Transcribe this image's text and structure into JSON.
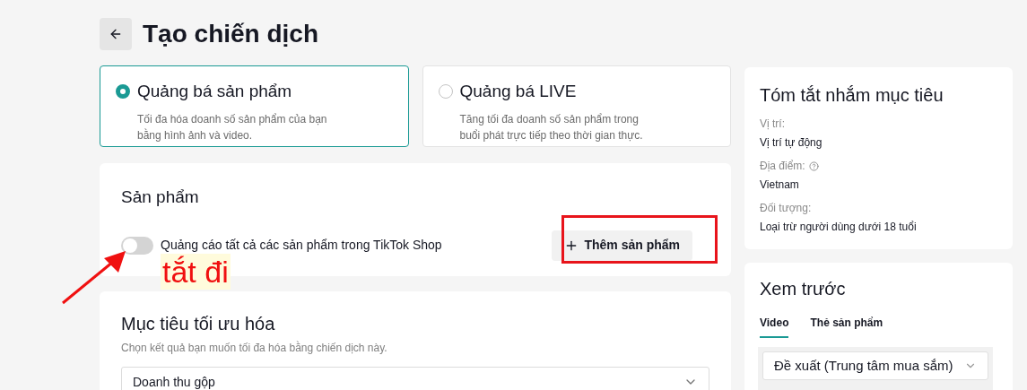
{
  "header": {
    "title": "Tạo chiến dịch"
  },
  "promo_options": [
    {
      "title": "Quảng bá sản phẩm",
      "description": "Tối đa hóa doanh số sản phẩm của bạn\nbằng hình ảnh và video.",
      "selected": true
    },
    {
      "title": "Quảng bá LIVE",
      "description": "Tăng tối đa doanh số sản phẩm trong\nbuổi phát trực tiếp theo thời gian thực.",
      "selected": false
    }
  ],
  "products": {
    "title": "Sản phẩm",
    "toggle": {
      "label": "Quảng cáo tất cả các sản phẩm trong TikTok Shop",
      "on": false
    },
    "add_button": "Thêm sản phẩm"
  },
  "annotation": {
    "text": "tắt đi"
  },
  "optimization": {
    "title": "Mục tiêu tối ưu hóa",
    "subtitle": "Chọn kết quả bạn muốn tối đa hóa bằng chiến dịch này.",
    "select_value": "Doanh thu gộp"
  },
  "targeting_summary": {
    "title": "Tóm tắt nhắm mục tiêu",
    "items": [
      {
        "label": "Vị trí:",
        "value": "Vị trí tự động",
        "help": false
      },
      {
        "label": "Địa điểm:",
        "value": "Vietnam",
        "help": true
      },
      {
        "label": "Đối tượng:",
        "value": "Loại trừ người dùng dưới 18 tuổi",
        "help": false
      }
    ]
  },
  "preview": {
    "title": "Xem trước",
    "tabs": [
      {
        "label": "Video",
        "selected": true
      },
      {
        "label": "Thẻ sản phẩm",
        "selected": false
      }
    ],
    "select_value": "Đề xuất (Trung tâm mua sắm)"
  }
}
